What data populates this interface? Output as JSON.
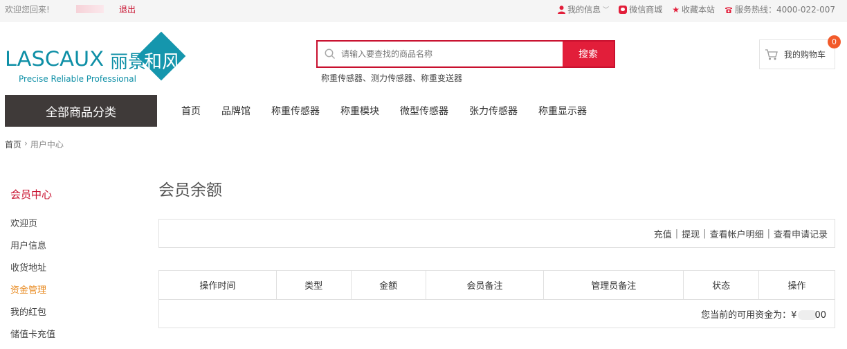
{
  "topbar": {
    "welcome": "欢迎您回来!",
    "logout": "退出",
    "my_info": "我的信息",
    "wechat_mall": "微信商城",
    "favorite": "收藏本站",
    "hotline": "服务热线：4000-022-007"
  },
  "logo": {
    "brand_en": "LASCAUX",
    "brand_cn_1": "丽景",
    "brand_cn_2": "和风",
    "tagline": "Precise Reliable Professional"
  },
  "search": {
    "placeholder": "请输入要查找的商品名称",
    "button": "搜索",
    "hotwords": "称重传感器、测力传感器、称重变送器"
  },
  "cart": {
    "label": "我的购物车",
    "count": "0"
  },
  "nav": {
    "all_categories": "全部商品分类",
    "items": [
      "首页",
      "品牌馆",
      "称重传感器",
      "称重模块",
      "微型传感器",
      "张力传感器",
      "称重显示器"
    ]
  },
  "breadcrumb": {
    "home": "首页",
    "separator": "›",
    "current": "用户中心"
  },
  "sidebar": {
    "title": "会员中心",
    "items": [
      "欢迎页",
      "用户信息",
      "收货地址",
      "资金管理",
      "我的红包",
      "储值卡充值"
    ],
    "active_index": 3
  },
  "main": {
    "title": "会员余额",
    "actions": [
      "充值",
      "提现",
      "查看帐户明细",
      "查看申请记录"
    ],
    "separator": "|",
    "table_headers": [
      "操作时间",
      "类型",
      "金额",
      "会员备注",
      "管理员备注",
      "状态",
      "操作"
    ],
    "balance_label": "您当前的可用资金为：¥",
    "balance_suffix": "00"
  },
  "colors": {
    "accent": "#c8102e",
    "search_button": "#e21e3a",
    "brand": "#0e8fa6",
    "nav_dark": "#3f3a39",
    "active_sidebar": "#e8891e"
  }
}
